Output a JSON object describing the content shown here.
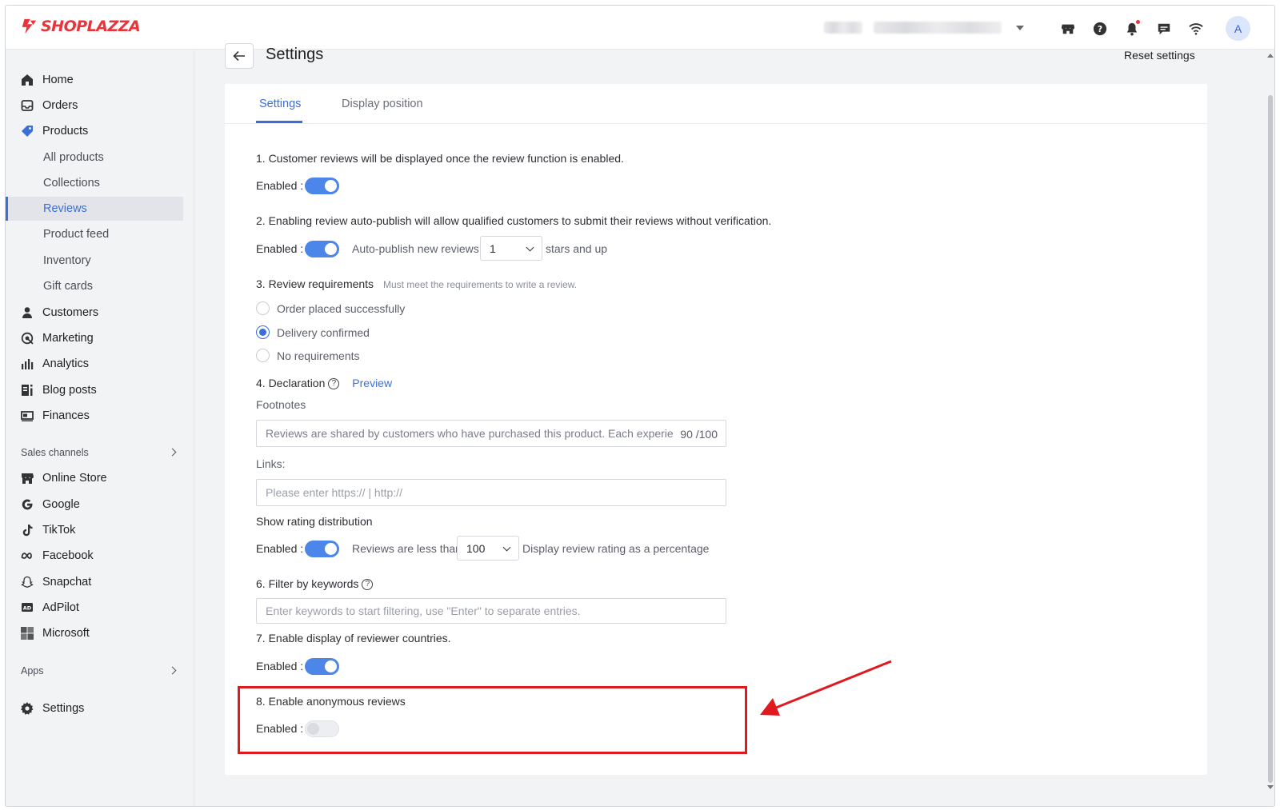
{
  "brand": {
    "name": "SHOPLAZZA",
    "color": "#e8343a"
  },
  "topbar": {
    "icons": [
      "store-icon",
      "help-icon",
      "bell-icon",
      "chat-icon",
      "wifi-icon"
    ],
    "avatar_initial": "A"
  },
  "sidebar": {
    "items": [
      {
        "label": "Home",
        "icon": "home-icon"
      },
      {
        "label": "Orders",
        "icon": "inbox-icon"
      },
      {
        "label": "Products",
        "icon": "tag-icon"
      },
      {
        "label": "Customers",
        "icon": "person-icon"
      },
      {
        "label": "Marketing",
        "icon": "target-icon"
      },
      {
        "label": "Analytics",
        "icon": "bar-chart-icon"
      },
      {
        "label": "Blog posts",
        "icon": "blog-icon"
      },
      {
        "label": "Finances",
        "icon": "finance-icon"
      }
    ],
    "product_subitems": [
      "All products",
      "Collections",
      "Reviews",
      "Product feed",
      "Inventory",
      "Gift cards"
    ],
    "active_subitem": "Reviews",
    "sales_channels_label": "Sales channels",
    "channels": [
      {
        "label": "Online Store",
        "icon": "store-icon"
      },
      {
        "label": "Google",
        "icon": "google-icon"
      },
      {
        "label": "TikTok",
        "icon": "tiktok-icon"
      },
      {
        "label": "Facebook",
        "icon": "meta-icon"
      },
      {
        "label": "Snapchat",
        "icon": "snapchat-icon"
      },
      {
        "label": "AdPilot",
        "icon": "adpilot-icon"
      },
      {
        "label": "Microsoft",
        "icon": "microsoft-icon"
      }
    ],
    "apps_label": "Apps",
    "settings_label": "Settings"
  },
  "header": {
    "title": "Settings",
    "reset_label": "Reset settings"
  },
  "tabs": [
    {
      "label": "Settings",
      "active": true
    },
    {
      "label": "Display position",
      "active": false
    }
  ],
  "settings": {
    "enabled_label": "Enabled :",
    "s1": {
      "text": "1. Customer reviews will be displayed once the review function is enabled.",
      "enabled": true
    },
    "s2": {
      "text": "2. Enabling review auto-publish will allow qualified customers to submit their reviews without verification.",
      "enabled": true,
      "auto_label": "Auto-publish new reviews",
      "stars_value": "1",
      "stars_suffix": "stars and up"
    },
    "s3": {
      "text": "3. Review requirements",
      "hint": "Must meet the requirements to write a review.",
      "options": [
        "Order placed successfully",
        "Delivery confirmed",
        "No requirements"
      ],
      "selected": "Delivery confirmed"
    },
    "s4": {
      "text": "4. Declaration",
      "preview": "Preview",
      "footnotes_label": "Footnotes",
      "footnotes_value": "Reviews are shared by customers who have purchased this product. Each experience",
      "footnotes_count": "90 /100",
      "links_label": "Links:",
      "links_placeholder": "Please enter https:// | http://"
    },
    "rating": {
      "text": "Show rating distribution",
      "enabled": true,
      "less_than_label": "Reviews are less than",
      "less_than_value": "100",
      "suffix": "Display review rating as a percentage"
    },
    "s6": {
      "text": "6. Filter by keywords",
      "placeholder": "Enter keywords to start filtering, use \"Enter\" to separate entries."
    },
    "s7": {
      "text": "7. Enable display of reviewer countries.",
      "enabled": true
    },
    "s8": {
      "text": "8. Enable anonymous reviews",
      "enabled": false
    }
  },
  "colors": {
    "accent": "#3a6fd8",
    "toggle_on": "#4b86e8",
    "highlight": "#e0191f"
  }
}
